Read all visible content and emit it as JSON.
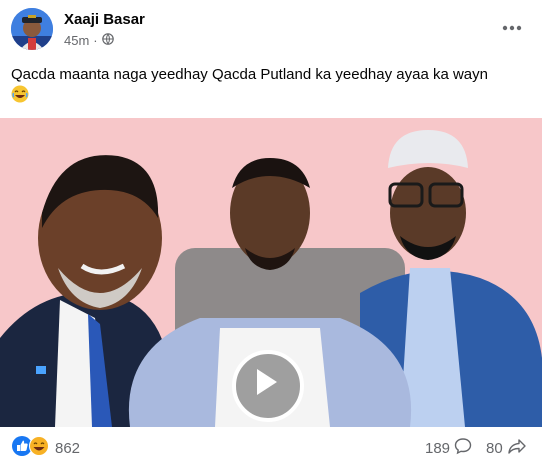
{
  "post": {
    "author": "Xaaji Basar",
    "time": "45m",
    "separator": "·",
    "privacy_icon": "globe-icon",
    "more_icon": "more-options-icon",
    "text": "Qacda maanta naga yeedhay Qacda Putland ka yeedhay ayaa ka wayn",
    "text_emoji": "laughing-emoji-icon"
  },
  "media": {
    "type": "video",
    "play_icon": "play-icon",
    "background": "#f7c7c9"
  },
  "footer": {
    "reaction_icons": [
      "like-icon",
      "haha-icon"
    ],
    "reaction_count": "862",
    "comment_count": "189",
    "comment_icon": "comment-icon",
    "share_count": "80",
    "share_icon": "share-icon"
  },
  "colors": {
    "like_blue": "#1877f2",
    "haha_yellow": "#f7b125",
    "secondary_text": "#65676b"
  }
}
